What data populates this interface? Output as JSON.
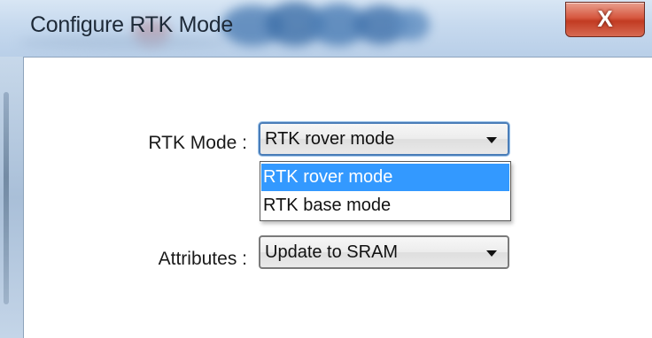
{
  "window": {
    "title": "Configure RTK Mode",
    "close_glyph": "X"
  },
  "form": {
    "rtk_mode": {
      "label": "RTK Mode :",
      "value": "RTK rover mode",
      "options": [
        "RTK rover mode",
        "RTK base mode"
      ],
      "highlighted_option": "RTK rover mode"
    },
    "attributes": {
      "label": "Attributes :",
      "value": "Update to SRAM"
    }
  },
  "colors": {
    "selection_highlight": "#3399ff",
    "close_button": "#c23b22",
    "focus_border": "#4a7db8"
  },
  "icons": {
    "close": "close-icon",
    "dropdown": "chevron-down-icon"
  }
}
